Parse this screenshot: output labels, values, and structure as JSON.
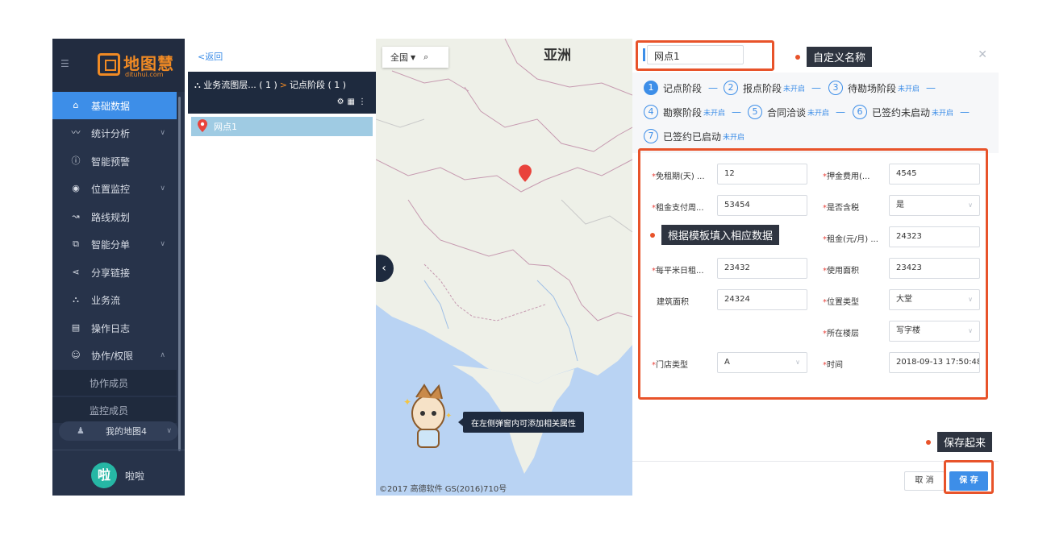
{
  "sidebar": {
    "logo_text": "地图慧",
    "logo_sub": "dituhui.com",
    "items": [
      {
        "label": "基础数据",
        "icon": "home-icon"
      },
      {
        "label": "统计分析",
        "icon": "chart-line-icon"
      },
      {
        "label": "智能预警",
        "icon": "info-icon"
      },
      {
        "label": "位置监控",
        "icon": "location-icon"
      },
      {
        "label": "路线规划",
        "icon": "route-icon"
      },
      {
        "label": "智能分单",
        "icon": "copy-icon"
      },
      {
        "label": "分享链接",
        "icon": "share-icon"
      },
      {
        "label": "业务流",
        "icon": "workflow-icon"
      },
      {
        "label": "操作日志",
        "icon": "calendar-icon"
      },
      {
        "label": "协作/权限",
        "icon": "users-icon"
      }
    ],
    "sub_items": [
      "协作成员",
      "监控成员"
    ],
    "my_map": "我的地图4",
    "user_avatar": "啦",
    "user_name": "啦啦"
  },
  "layer_panel": {
    "back": "<返回",
    "breadcrumb_left": "业务流图层... ( 1 )",
    "breadcrumb_arrow": ">",
    "breadcrumb_right": "记点阶段 ( 1 )",
    "point_label": "网点1"
  },
  "map": {
    "search_label": "全国",
    "region_label": "亚洲",
    "tooltip": "在左侧弹窗内可添加相关属性",
    "copyright": "©2017 高德软件 GS(2016)710号"
  },
  "form": {
    "name_value": "网点1",
    "steps": [
      {
        "num": "1",
        "label": "记点阶段",
        "status": ""
      },
      {
        "num": "2",
        "label": "报点阶段",
        "status": "未开启"
      },
      {
        "num": "3",
        "label": "待勘场阶段",
        "status": "未开启"
      },
      {
        "num": "4",
        "label": "勘察阶段",
        "status": "未开启"
      },
      {
        "num": "5",
        "label": "合同洽谈",
        "status": "未开启"
      },
      {
        "num": "6",
        "label": "已签约未启动",
        "status": "未开启"
      },
      {
        "num": "7",
        "label": "已签约已启动",
        "status": "未开启"
      }
    ],
    "fields": {
      "f1": {
        "label": "免租期(天) ...",
        "value": "12"
      },
      "f2": {
        "label": "押金费用(...",
        "value": "4545"
      },
      "f3": {
        "label": "租金支付周...",
        "value": "53454"
      },
      "f4": {
        "label": "是否含税",
        "value": "是"
      },
      "f5": {
        "label": "租金(元/月) ...",
        "value": "24323"
      },
      "f6": {
        "label": "每平米日租...",
        "value": "23432"
      },
      "f7": {
        "label": "使用面积",
        "value": "23423"
      },
      "f8": {
        "label": "建筑面积",
        "value": "24324"
      },
      "f9": {
        "label": "位置类型",
        "value": "大堂"
      },
      "f10": {
        "label": "所在楼层",
        "value": "写字楼"
      },
      "f11": {
        "label": "门店类型",
        "value": "A"
      },
      "f12": {
        "label": "时间",
        "value": "2018-09-13 17:50:48"
      }
    },
    "cancel": "取 消",
    "save": "保 存"
  },
  "annotations": {
    "name": "自定义名称",
    "fill": "根据模板填入相应数据",
    "save": "保存起来"
  },
  "colors": {
    "accent": "#3d8ee8",
    "annotation": "#e8532a",
    "sidebar_bg": "#27334a",
    "brand": "#f08a24"
  }
}
